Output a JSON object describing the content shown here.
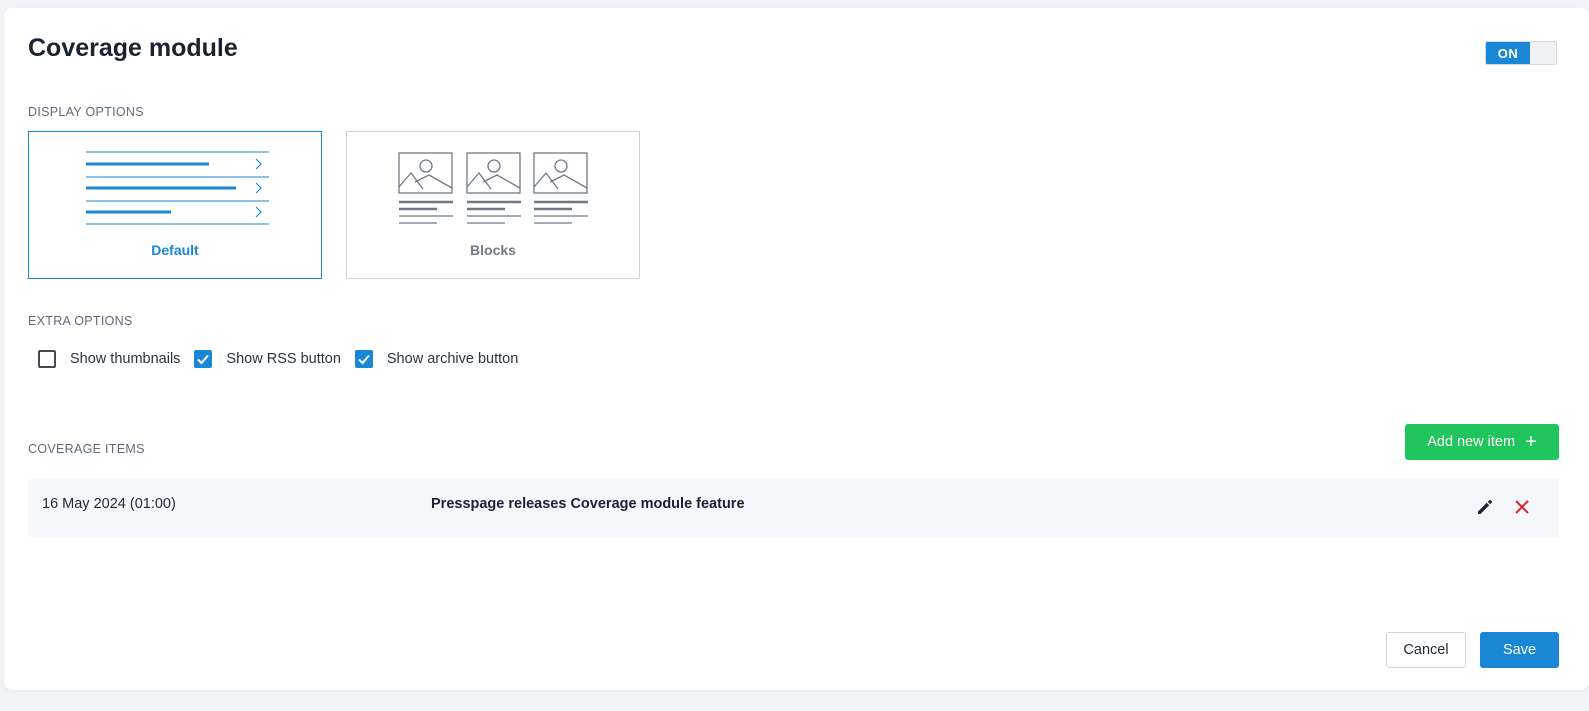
{
  "module": {
    "title": "Coverage module",
    "toggle_label": "ON",
    "toggle_on": true
  },
  "display_options": {
    "label": "DISPLAY OPTIONS",
    "options": [
      {
        "label": "Default",
        "selected": true,
        "icon": "list-layout-icon"
      },
      {
        "label": "Blocks",
        "selected": false,
        "icon": "image-blocks-layout-icon"
      }
    ]
  },
  "extra_options": {
    "label": "EXTRA OPTIONS",
    "items": [
      {
        "label": "Show thumbnails",
        "checked": false
      },
      {
        "label": "Show RSS button",
        "checked": true
      },
      {
        "label": "Show archive button",
        "checked": true
      }
    ]
  },
  "coverage_items": {
    "label": "COVERAGE ITEMS",
    "add_button": "Add new item",
    "rows": [
      {
        "date": "16 May 2024 (01:00)",
        "title": "Presspage releases Coverage module feature"
      }
    ]
  },
  "footer": {
    "cancel": "Cancel",
    "save": "Save"
  },
  "colors": {
    "accent": "#1a86d6",
    "add_button": "#21c55d",
    "delete": "#d7262f"
  }
}
